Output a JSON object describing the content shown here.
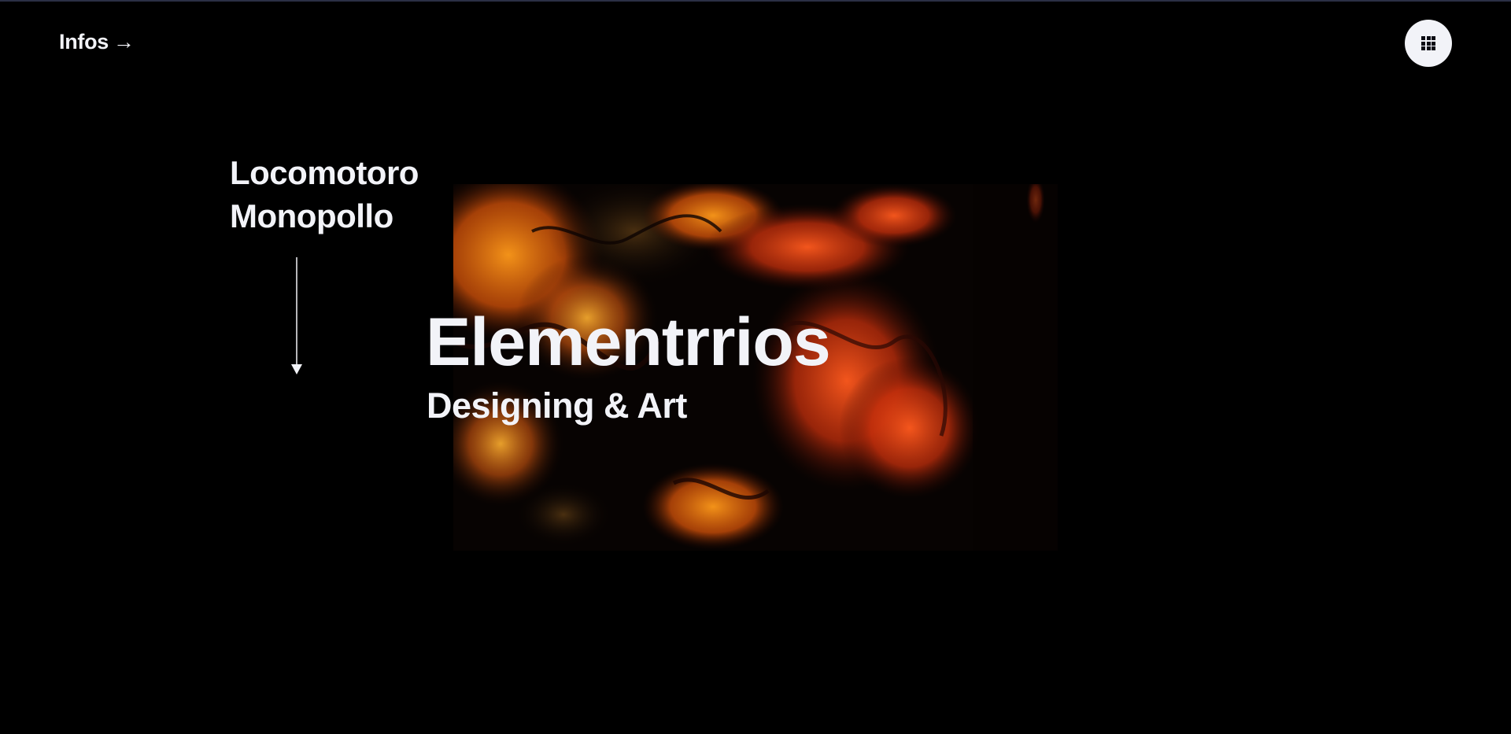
{
  "header": {
    "infos_label": "Infos",
    "infos_arrow": "→",
    "menu_icon": "grid-icon"
  },
  "side": {
    "title_line1": "Locomotoro",
    "title_line2": "Monopollo",
    "scroll_icon": "arrow-down-icon"
  },
  "hero": {
    "title": "Elementrrios",
    "subtitle": "Designing & Art",
    "image_desc": "abstract-fluid-art"
  },
  "colors": {
    "background": "#000000",
    "text": "#f2f3f8",
    "accent_orange": "#ff6a0a",
    "accent_red": "#e23a14"
  }
}
